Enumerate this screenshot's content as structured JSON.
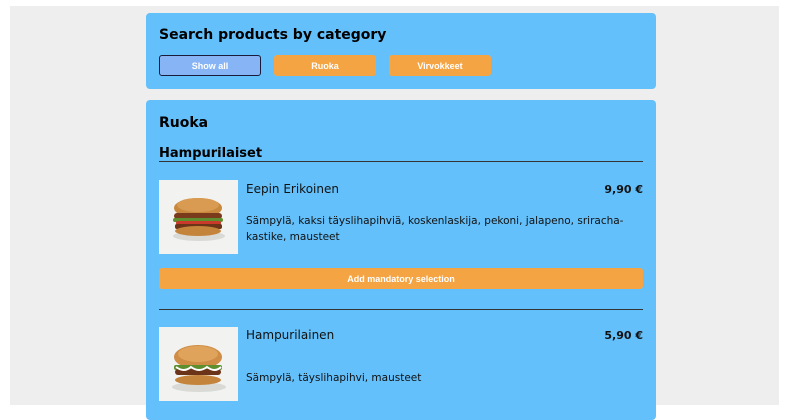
{
  "search": {
    "title": "Search products by category",
    "filters": [
      {
        "label": "Show all",
        "active": true
      },
      {
        "label": "Ruoka",
        "active": false
      },
      {
        "label": "Virvokkeet",
        "active": false
      }
    ]
  },
  "menu": {
    "category": "Ruoka",
    "subcategory": "Hampurilaiset",
    "products": [
      {
        "name": "Eepin Erikoinen",
        "price": "9,90 €",
        "description": "Sämpylä, kaksi täyslihapihviä, koskenlaskija, pekoni, jalapeno, sriracha-kastike, mausteet",
        "image_icon": "burger-image",
        "button_label": "Add mandatory selection"
      },
      {
        "name": "Hampurilainen",
        "price": "5,90 €",
        "description": "Sämpylä, täyslihapihvi, mausteet",
        "image_icon": "burger-image"
      }
    ]
  },
  "colors": {
    "card_bg": "#63c0fb",
    "accent_orange": "#f5a444",
    "active_filter": "#86b4f4",
    "page_bg": "#eeeeee"
  }
}
